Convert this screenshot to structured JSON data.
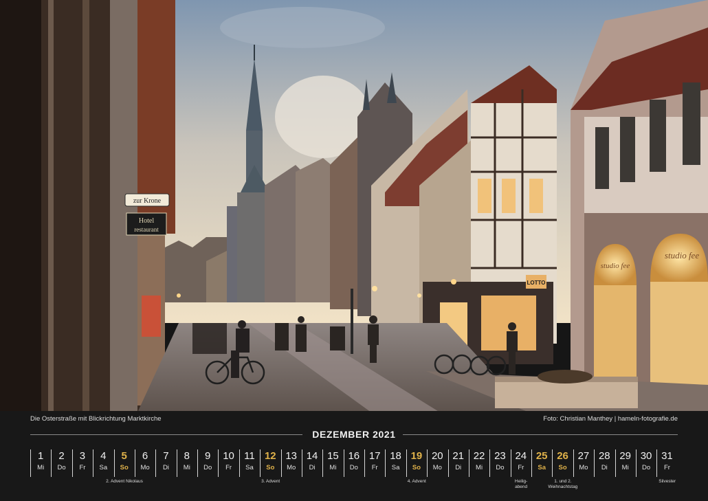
{
  "photo": {
    "caption": "Die Osterstraße mit Blickrichtung Marktkirche",
    "credit": "Foto: Christian Manthey | hameln-fotografie.de",
    "signs": {
      "krone": "zur Krone",
      "hotel": "Hotel",
      "restaurant": "restaurant",
      "shop1": "studio fee",
      "shop2": "studio fee",
      "lotto": "LOTTO"
    }
  },
  "calendar": {
    "month": "DEZEMBER 2021",
    "days": [
      {
        "num": "1",
        "wd": "Mi",
        "note": ""
      },
      {
        "num": "2",
        "wd": "Do",
        "note": ""
      },
      {
        "num": "3",
        "wd": "Fr",
        "note": ""
      },
      {
        "num": "4",
        "wd": "Sa",
        "note": ""
      },
      {
        "num": "5",
        "wd": "So",
        "note": "2. Advent Nikolaus"
      },
      {
        "num": "6",
        "wd": "Mo",
        "note": ""
      },
      {
        "num": "7",
        "wd": "Di",
        "note": ""
      },
      {
        "num": "8",
        "wd": "Mi",
        "note": ""
      },
      {
        "num": "9",
        "wd": "Do",
        "note": ""
      },
      {
        "num": "10",
        "wd": "Fr",
        "note": ""
      },
      {
        "num": "11",
        "wd": "Sa",
        "note": ""
      },
      {
        "num": "12",
        "wd": "So",
        "note": "3. Advent"
      },
      {
        "num": "13",
        "wd": "Mo",
        "note": ""
      },
      {
        "num": "14",
        "wd": "Di",
        "note": ""
      },
      {
        "num": "15",
        "wd": "Mi",
        "note": ""
      },
      {
        "num": "16",
        "wd": "Do",
        "note": ""
      },
      {
        "num": "17",
        "wd": "Fr",
        "note": ""
      },
      {
        "num": "18",
        "wd": "Sa",
        "note": ""
      },
      {
        "num": "19",
        "wd": "So",
        "note": "4. Advent"
      },
      {
        "num": "20",
        "wd": "Mo",
        "note": ""
      },
      {
        "num": "21",
        "wd": "Di",
        "note": ""
      },
      {
        "num": "22",
        "wd": "Mi",
        "note": ""
      },
      {
        "num": "23",
        "wd": "Do",
        "note": ""
      },
      {
        "num": "24",
        "wd": "Fr",
        "note": "Heilig-\nabend"
      },
      {
        "num": "25",
        "wd": "Sa",
        "note": ""
      },
      {
        "num": "26",
        "wd": "So",
        "note": "1. und 2.\nWeihnachtstag"
      },
      {
        "num": "27",
        "wd": "Mo",
        "note": ""
      },
      {
        "num": "28",
        "wd": "Di",
        "note": ""
      },
      {
        "num": "29",
        "wd": "Mi",
        "note": ""
      },
      {
        "num": "30",
        "wd": "Do",
        "note": ""
      },
      {
        "num": "31",
        "wd": "Fr",
        "note": "Silvester"
      }
    ],
    "highlight_days": [
      "5",
      "12",
      "19",
      "25",
      "26"
    ],
    "highlight_color": "#e0b24a"
  }
}
